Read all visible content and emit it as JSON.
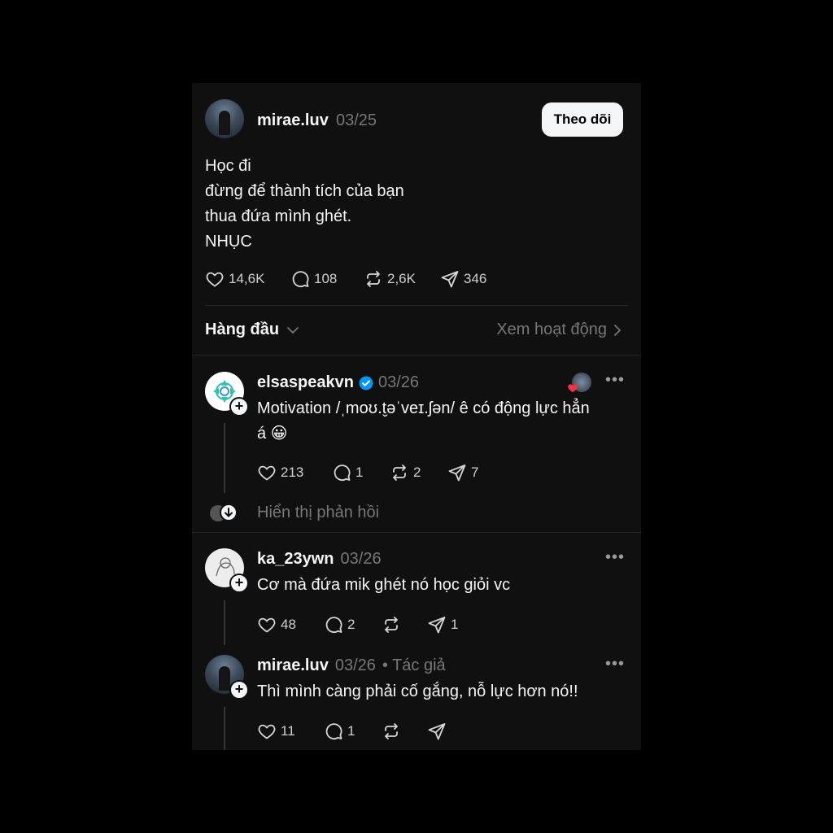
{
  "post": {
    "username": "mirae.luv",
    "date": "03/25",
    "follow_label": "Theo dõi",
    "lines": [
      "Học đi",
      "đừng để thành tích của bạn",
      "thua đứa mình ghét.",
      "NHỤC"
    ],
    "likes": "14,6K",
    "comments": "108",
    "reposts": "2,6K",
    "shares": "346"
  },
  "sort": {
    "label": "Hàng đầu",
    "activity_label": "Xem hoạt động"
  },
  "replies": [
    {
      "username": "elsaspeakvn",
      "verified": true,
      "date": "03/26",
      "lines": [
        "Motivation /ˌmoʊ.t̬əˈveɪ.ʃən/ ê có động lực hẳn",
        "á 😀"
      ],
      "likes": "213",
      "comments": "1",
      "reposts": "2",
      "shares": "7",
      "show_replies_label": "Hiển thị phản hồi"
    },
    {
      "username": "ka_23ywn",
      "date": "03/26",
      "lines": [
        "Cơ mà đứa mik ghét nó học giỏi vc"
      ],
      "likes": "48",
      "comments": "2",
      "reposts": "",
      "shares": "1"
    },
    {
      "username": "mirae.luv",
      "date": "03/26",
      "author_tag": "• Tác giả",
      "lines": [
        "Thì mình càng phải cố gắng, nỗ lực hơn nó!!"
      ],
      "likes": "11",
      "comments": "1",
      "reposts": "",
      "shares": ""
    }
  ],
  "colors": {
    "background": "#000000",
    "card": "#101010",
    "text": "#f3f5f7",
    "muted": "#777777",
    "verified": "#0095f6",
    "heart": "#ff3040"
  }
}
